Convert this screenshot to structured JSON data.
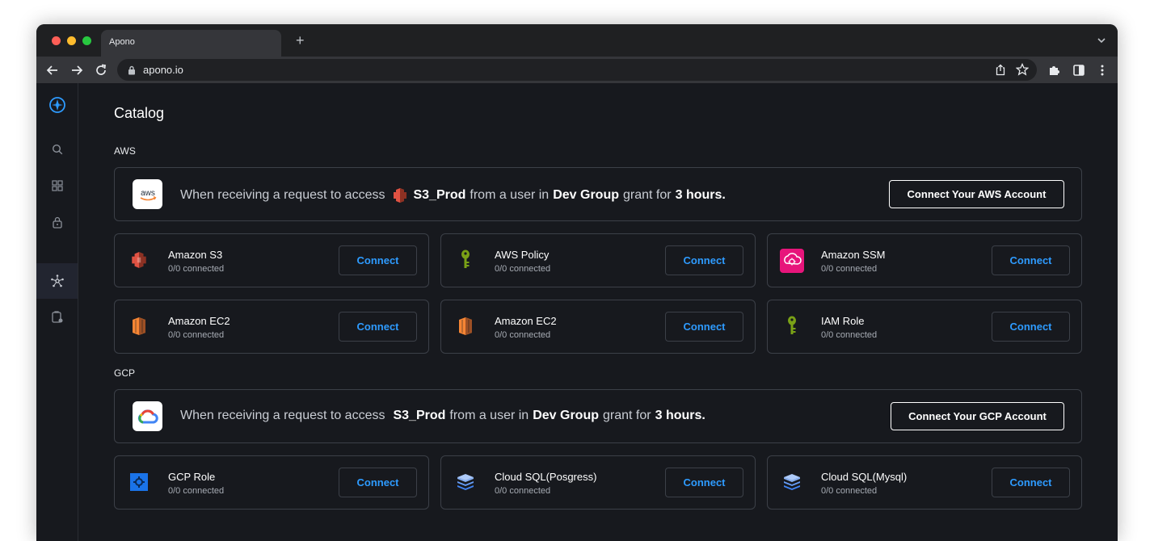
{
  "browser": {
    "tab_title": "Apono",
    "new_tab": "+",
    "url": "apono.io"
  },
  "page": {
    "title": "Catalog"
  },
  "aws": {
    "section_label": "AWS",
    "banner": {
      "logo_text": "aws",
      "prefix": "When receiving a request to access",
      "resource": "S3_Prod",
      "mid": "from a user in",
      "group": "Dev Group",
      "grant": "grant for",
      "duration": "3 hours.",
      "button": "Connect Your AWS Account"
    },
    "cards": [
      {
        "title": "Amazon S3",
        "status": "0/0 connected",
        "button": "Connect",
        "icon": "amazon-s3-icon"
      },
      {
        "title": "AWS Policy",
        "status": "0/0 connected",
        "button": "Connect",
        "icon": "key-icon"
      },
      {
        "title": "Amazon SSM",
        "status": "0/0 connected",
        "button": "Connect",
        "icon": "amazon-ssm-icon"
      },
      {
        "title": "Amazon EC2",
        "status": "0/0 connected",
        "button": "Connect",
        "icon": "amazon-ec2-icon"
      },
      {
        "title": "Amazon EC2",
        "status": "0/0 connected",
        "button": "Connect",
        "icon": "amazon-ec2-icon"
      },
      {
        "title": "IAM Role",
        "status": "0/0 connected",
        "button": "Connect",
        "icon": "key-icon"
      }
    ]
  },
  "gcp": {
    "section_label": "GCP",
    "banner": {
      "prefix": "When receiving a request to access",
      "resource": "S3_Prod",
      "mid": "from a user in",
      "group": "Dev Group",
      "grant": "grant for",
      "duration": "3 hours.",
      "button": "Connect Your GCP Account"
    },
    "cards": [
      {
        "title": "GCP Role",
        "status": "0/0 connected",
        "button": "Connect",
        "icon": "gcp-role-icon"
      },
      {
        "title": "Cloud SQL(Posgress)",
        "status": "0/0 connected",
        "button": "Connect",
        "icon": "cloud-sql-icon"
      },
      {
        "title": "Cloud SQL(Mysql)",
        "status": "0/0 connected",
        "button": "Connect",
        "icon": "cloud-sql-icon"
      }
    ]
  },
  "colors": {
    "accent": "#2e9bff",
    "background": "#17191e",
    "border": "#3c4048",
    "aws_orange": "#f58534",
    "s3_red": "#e05243",
    "ssm_pink": "#e7157b",
    "key_green": "#7aa116"
  }
}
